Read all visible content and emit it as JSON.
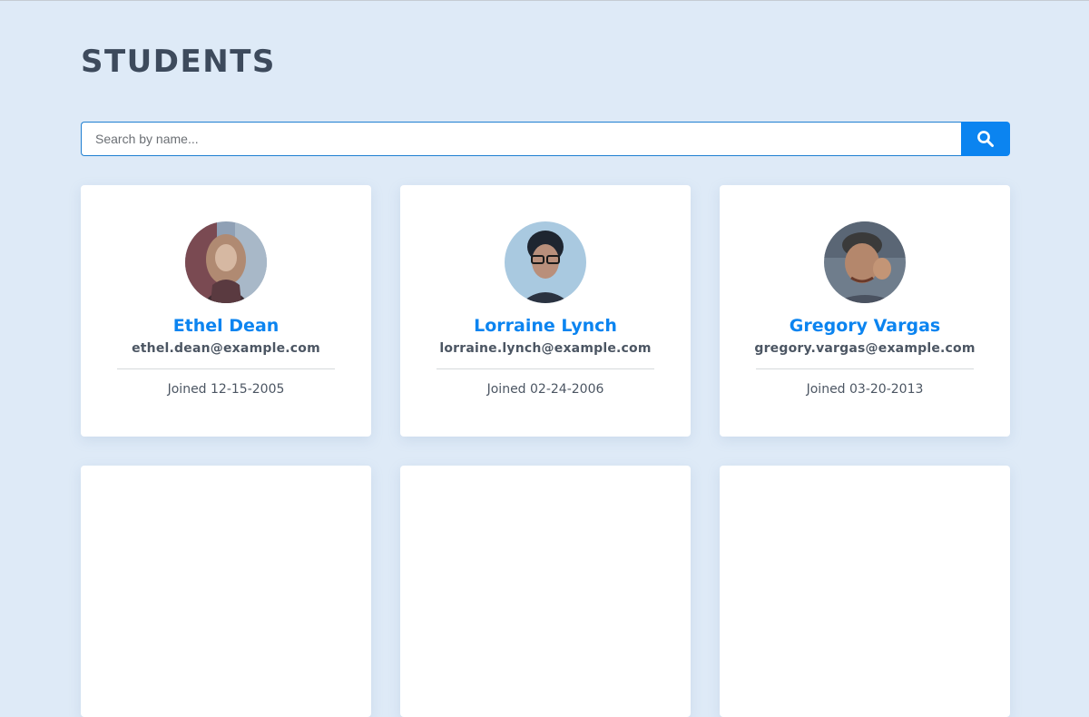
{
  "page": {
    "title": "STUDENTS"
  },
  "search": {
    "placeholder": "Search by name...",
    "icon": "search-icon"
  },
  "colors": {
    "accent": "#0b84f0",
    "background": "#deeaf7",
    "text": "#3d4a5c"
  },
  "students": [
    {
      "name": "Ethel Dean",
      "email": "ethel.dean@example.com",
      "joined": "Joined 12-15-2005"
    },
    {
      "name": "Lorraine Lynch",
      "email": "lorraine.lynch@example.com",
      "joined": "Joined 02-24-2006"
    },
    {
      "name": "Gregory Vargas",
      "email": "gregory.vargas@example.com",
      "joined": "Joined 03-20-2013"
    }
  ]
}
